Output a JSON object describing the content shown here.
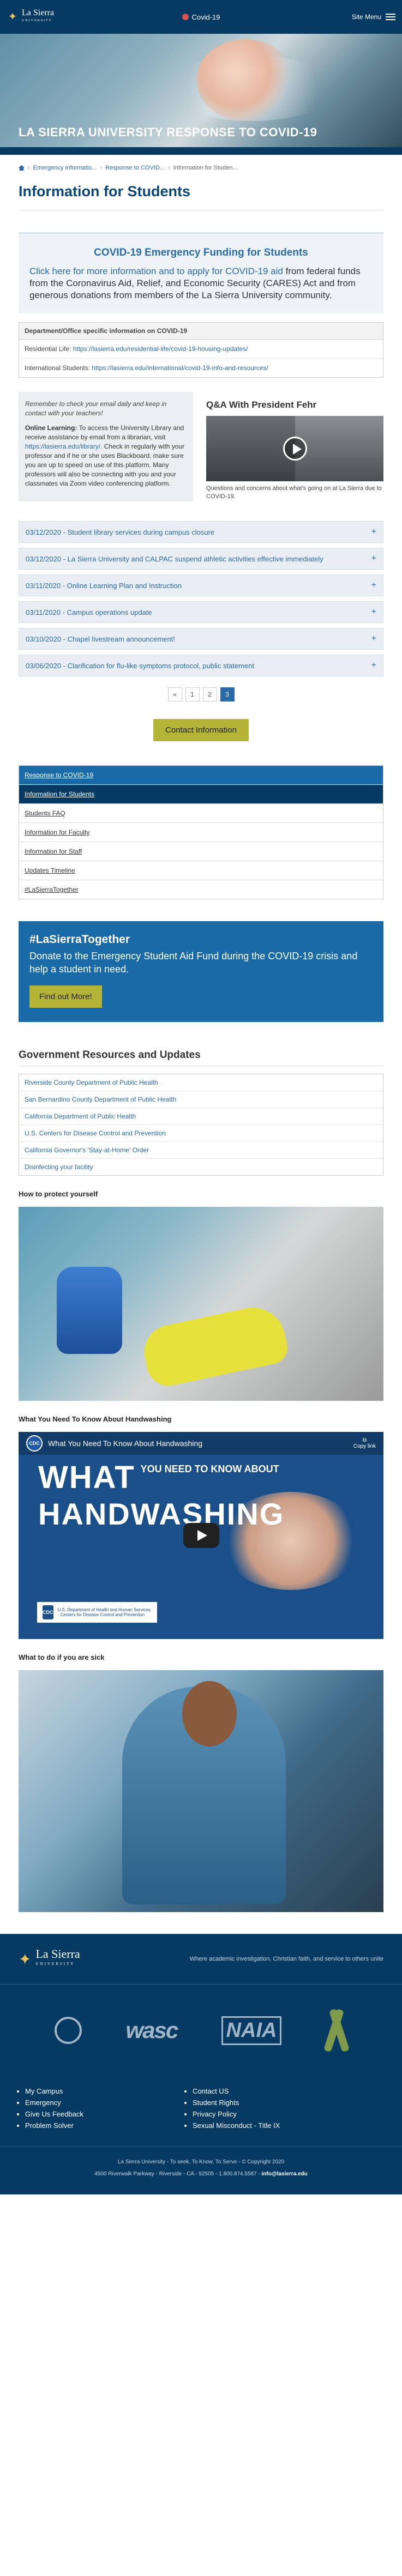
{
  "header": {
    "logo_text": "La Sierra",
    "logo_sub": "UNIVERSITY",
    "covid_link": "Covid-19",
    "menu_label": "Site Menu"
  },
  "hero": {
    "title": "LA SIERRA UNIVERSITY RESPONSE TO COVID-19"
  },
  "breadcrumb": {
    "items": [
      "Emergency Informatio...",
      "Response to COVID...",
      "Information for Studen..."
    ]
  },
  "page_title": "Information for Students",
  "funding": {
    "title": "COVID-19 Emergency Funding for Students",
    "link_text": "Click here for more information and to apply for COVID-19 aid",
    "body": " from federal funds from the Coronavirus Aid, Relief, and Economic Security (CARES) Act and from generous donations from members of the La Sierra University community."
  },
  "dept": {
    "heading": "Department/Office specific information on COVID-19",
    "rows": [
      {
        "label": "Residential Life: ",
        "link": "https://lasierra.edu/residential-life/covid-19-housing-updates/"
      },
      {
        "label": "International Students: ",
        "link": "https://lasierra.edu/international/covid-19-info-and-resources/"
      }
    ]
  },
  "note": {
    "reminder": "Remember to check your email daily and keep in contact with your teachers!",
    "online_label": "Online Learning:",
    "online_text_1": " To access the University Library and receive assistance by email from a librarian, visit ",
    "library_link": "https://lasierra.edu/library/",
    "online_text_2": ". Check in regularly with your professor and if he or she uses Blackboard, make sure you are up to speed on use of this platform. Many professors will also be connecting with you and your classmates via Zoom video conferencing platform."
  },
  "qa": {
    "title": "Q&A With President Fehr",
    "caption": "Questions and concerns about what's going on at La Sierra due to COVID-19."
  },
  "news": [
    "03/12/2020 - Student library services during campus closure",
    "03/12/2020 - La Sierra University and CALPAC suspend athletic activities effective immediately",
    "03/11/2020 - Online Learning Plan and Instruction",
    "03/11/2020 - Campus operations update",
    "03/10/2020 - Chapel livestream announcement!",
    "03/06/2020 - Clarification for flu-like symptoms protocol, public statement"
  ],
  "pagination": {
    "prev": "«",
    "pages": [
      "1",
      "2",
      "3"
    ],
    "current": "3"
  },
  "contact_button": "Contact Information",
  "subnav": {
    "parent": "Response to COVID-19",
    "items": [
      {
        "label": "Information for Students",
        "active": true
      },
      {
        "label": "Students FAQ",
        "active": false
      },
      {
        "label": "Information for Faculty",
        "active": false
      },
      {
        "label": "Information for Staff",
        "active": false
      },
      {
        "label": "Updates Timeline",
        "active": false
      },
      {
        "label": "#LaSierraTogether",
        "active": false
      }
    ]
  },
  "together": {
    "title": "#LaSierraTogether",
    "text": "Donate to the Emergency Student Aid Fund during the COVID-19 crisis and help a student in need.",
    "button": "Find out More!"
  },
  "gov": {
    "title": "Government Resources and Updates",
    "links": [
      "Riverside County Department of Public Health",
      "San Bernardino County Department of Public Health",
      "California Department of Public Health",
      "U.S. Centers for Disease Control and Prevention",
      "California Governor's 'Stay-at-Home' Order",
      "Disinfecting your facility"
    ]
  },
  "media": {
    "protect_title": "How to protect yourself",
    "handwashing_title": "What You Need To Know About Handwashing",
    "video_bar_title": "What You Need To Know About Handwashing",
    "cdc_label": "CDC",
    "copy_link": "Copy link",
    "big_what": "WHAT",
    "big_need": "YOU NEED TO KNOW ABOUT",
    "big_hand": "HANDWASHING",
    "sick_title": "What to do if you are sick"
  },
  "footer": {
    "logo_text": "La Sierra",
    "logo_sub": "UNIVERSITY",
    "tagline": "Where academic investigation, Christian faith, and service to others unite",
    "links_left": [
      "My Campus",
      "Emergency",
      "Give Us Feedback",
      "Problem Solver"
    ],
    "links_right": [
      "Contact US",
      "Student Rights",
      "Privacy Policy",
      "Sexual Misconduct - Title IX"
    ],
    "copyright": "La Sierra University - To seek, To Know, To Serve - © Copyright 2020",
    "address": "4500 Riverwalk Parkway - Riverside - CA - 92505 - 1.800.874.5587 - ",
    "email": "info@lasierra.edu"
  }
}
